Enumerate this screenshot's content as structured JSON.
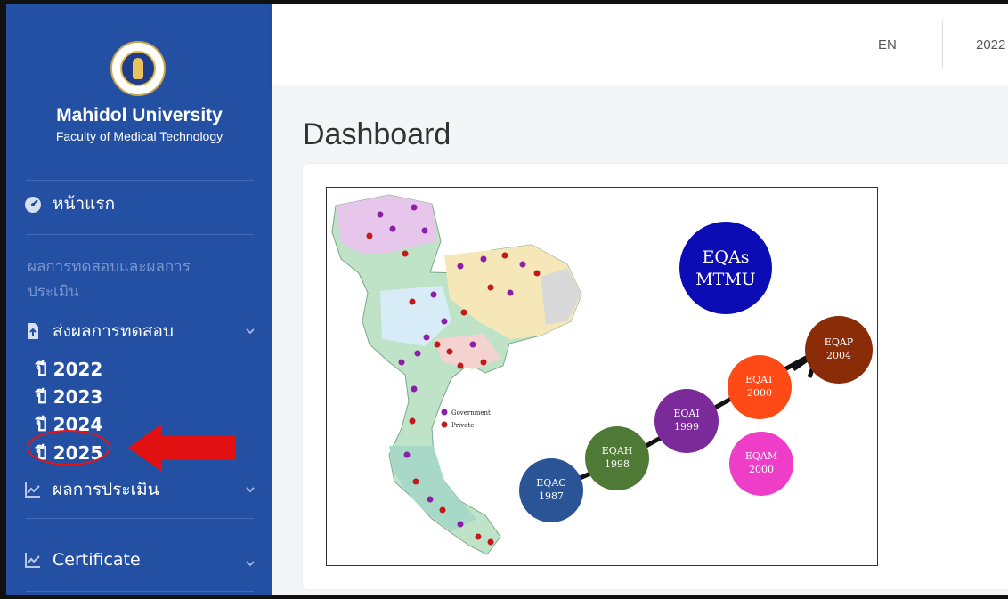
{
  "brand": {
    "title": "Mahidol University",
    "subtitle": "Faculty of Medical Technology"
  },
  "sidebar": {
    "home_label": "หน้าแรก",
    "section_label": "ผลการทดสอบและผลการประเมิน",
    "submit_menu": "ส่งผลการทดสอบ",
    "years": [
      "ปี 2022",
      "ปี 2023",
      "ปี 2024",
      "ปี 2025"
    ],
    "evaluation_menu": "ผลการประเมิน",
    "certificate_menu": "Certificate"
  },
  "topbar": {
    "language": "EN",
    "year": "2022"
  },
  "main": {
    "page_title": "Dashboard"
  },
  "figure": {
    "title_lines": [
      "EQAs",
      "MTMU"
    ],
    "legend": [
      "Government",
      "Private"
    ],
    "programs": [
      {
        "name": "EQAC",
        "year": "1987",
        "color": "#2a5496"
      },
      {
        "name": "EQAH",
        "year": "1998",
        "color": "#4e7a36"
      },
      {
        "name": "EQAI",
        "year": "1999",
        "color": "#7a2a99"
      },
      {
        "name": "EQAT",
        "year": "2000",
        "color": "#ff4a17"
      },
      {
        "name": "EQAP",
        "year": "2004",
        "color": "#8a2c08"
      },
      {
        "name": "EQAM",
        "year": "2000",
        "color": "#ee3ec8"
      }
    ]
  },
  "colors": {
    "sidebar": "#2350a3",
    "annotation": "#e11111"
  }
}
